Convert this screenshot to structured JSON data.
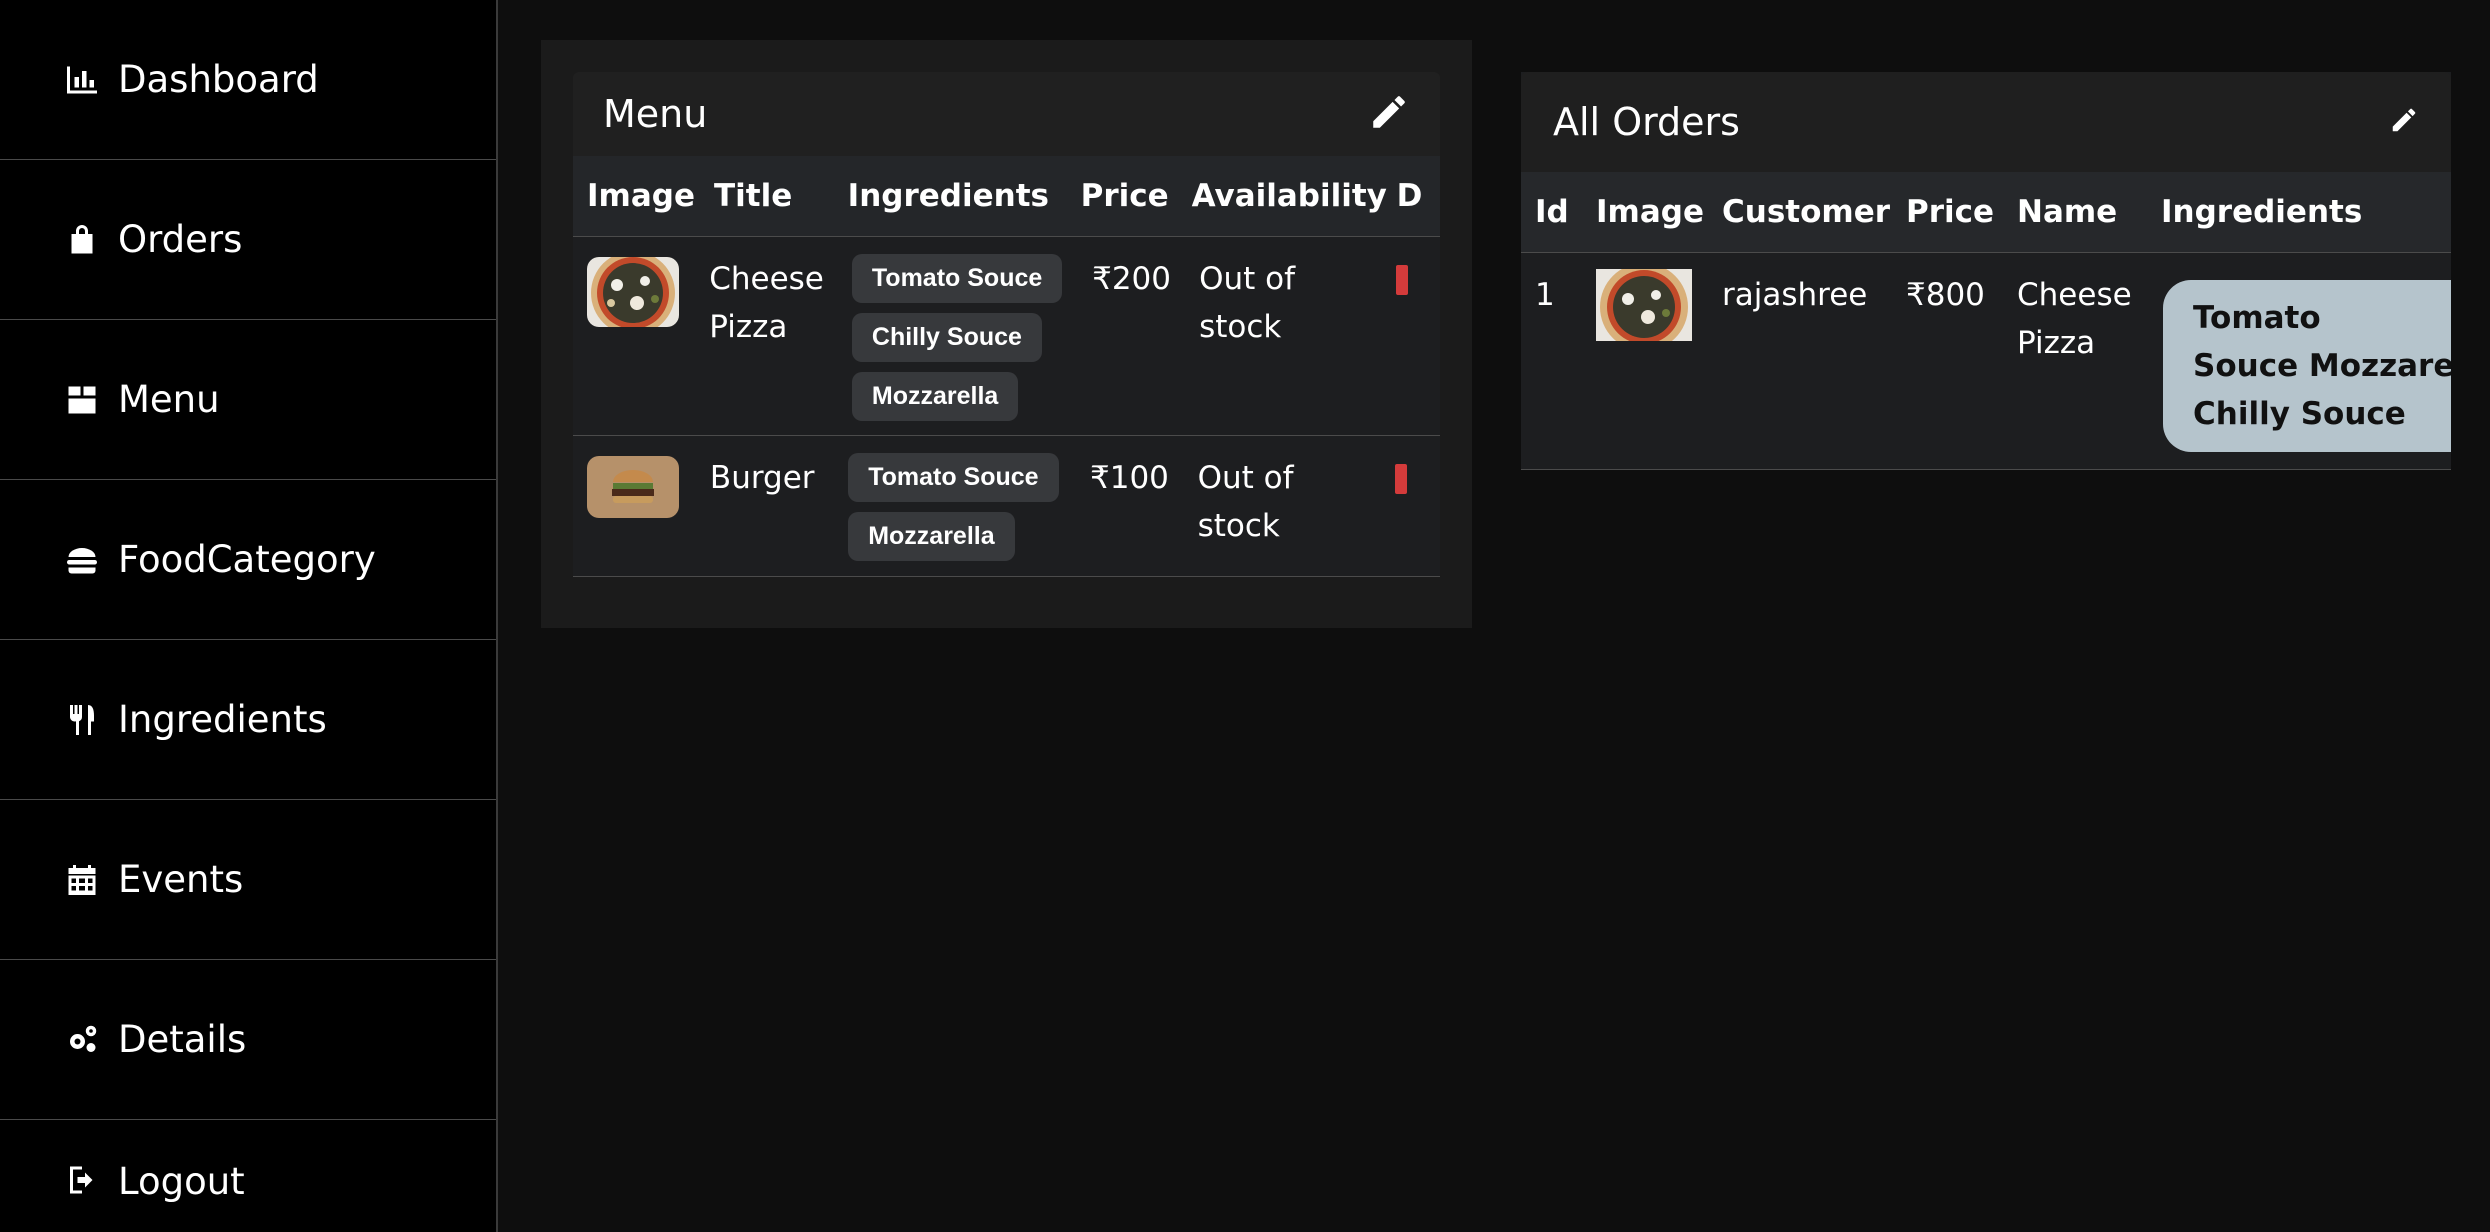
{
  "sidebar": {
    "items": [
      {
        "label": "Dashboard",
        "icon": "chart-bar-icon"
      },
      {
        "label": "Orders",
        "icon": "shopping-bag-icon"
      },
      {
        "label": "Menu",
        "icon": "box-icon"
      },
      {
        "label": "FoodCategory",
        "icon": "burger-icon"
      },
      {
        "label": "Ingredients",
        "icon": "utensils-icon"
      },
      {
        "label": "Events",
        "icon": "calendar-icon"
      },
      {
        "label": "Details",
        "icon": "gears-icon"
      },
      {
        "label": "Logout",
        "icon": "logout-icon"
      }
    ]
  },
  "menu": {
    "title": "Menu",
    "columns": [
      "Image",
      "Title",
      "Ingredients",
      "Price",
      "Availability",
      "D"
    ],
    "rows": [
      {
        "image": "pizza-thumbnail",
        "title_line1": "Cheese",
        "title_line2": "Pizza",
        "ingredients": [
          "Tomato Souce",
          "Chilly Souce",
          "Mozzarella"
        ],
        "price": "₹200",
        "availability_line1": "Out of",
        "availability_line2": "stock"
      },
      {
        "image": "burger-thumbnail",
        "title_line1": "Burger",
        "title_line2": "",
        "ingredients": [
          "Tomato Souce",
          "Mozzarella"
        ],
        "price": "₹100",
        "availability_line1": "Out of",
        "availability_line2": "stock"
      }
    ]
  },
  "orders": {
    "title": "All Orders",
    "columns": [
      "Id",
      "Image",
      "Customer",
      "Price",
      "Name",
      "Ingredients"
    ],
    "rows": [
      {
        "id": "1",
        "image": "pizza-thumbnail",
        "customer": "rajashree",
        "price": "₹800",
        "name_line1": "Cheese",
        "name_line2": "Pizza",
        "ingredients_lines": [
          "Tomato",
          "Souce Mozzarella",
          "Chilly Souce"
        ]
      }
    ]
  },
  "colors": {
    "background": "#0e0e0e",
    "sidebar": "#000000",
    "panel": "#1b1b1b",
    "chip": "#37393c",
    "ingredient_pill": "#b5c4cc",
    "delete": "#d43b3b"
  }
}
